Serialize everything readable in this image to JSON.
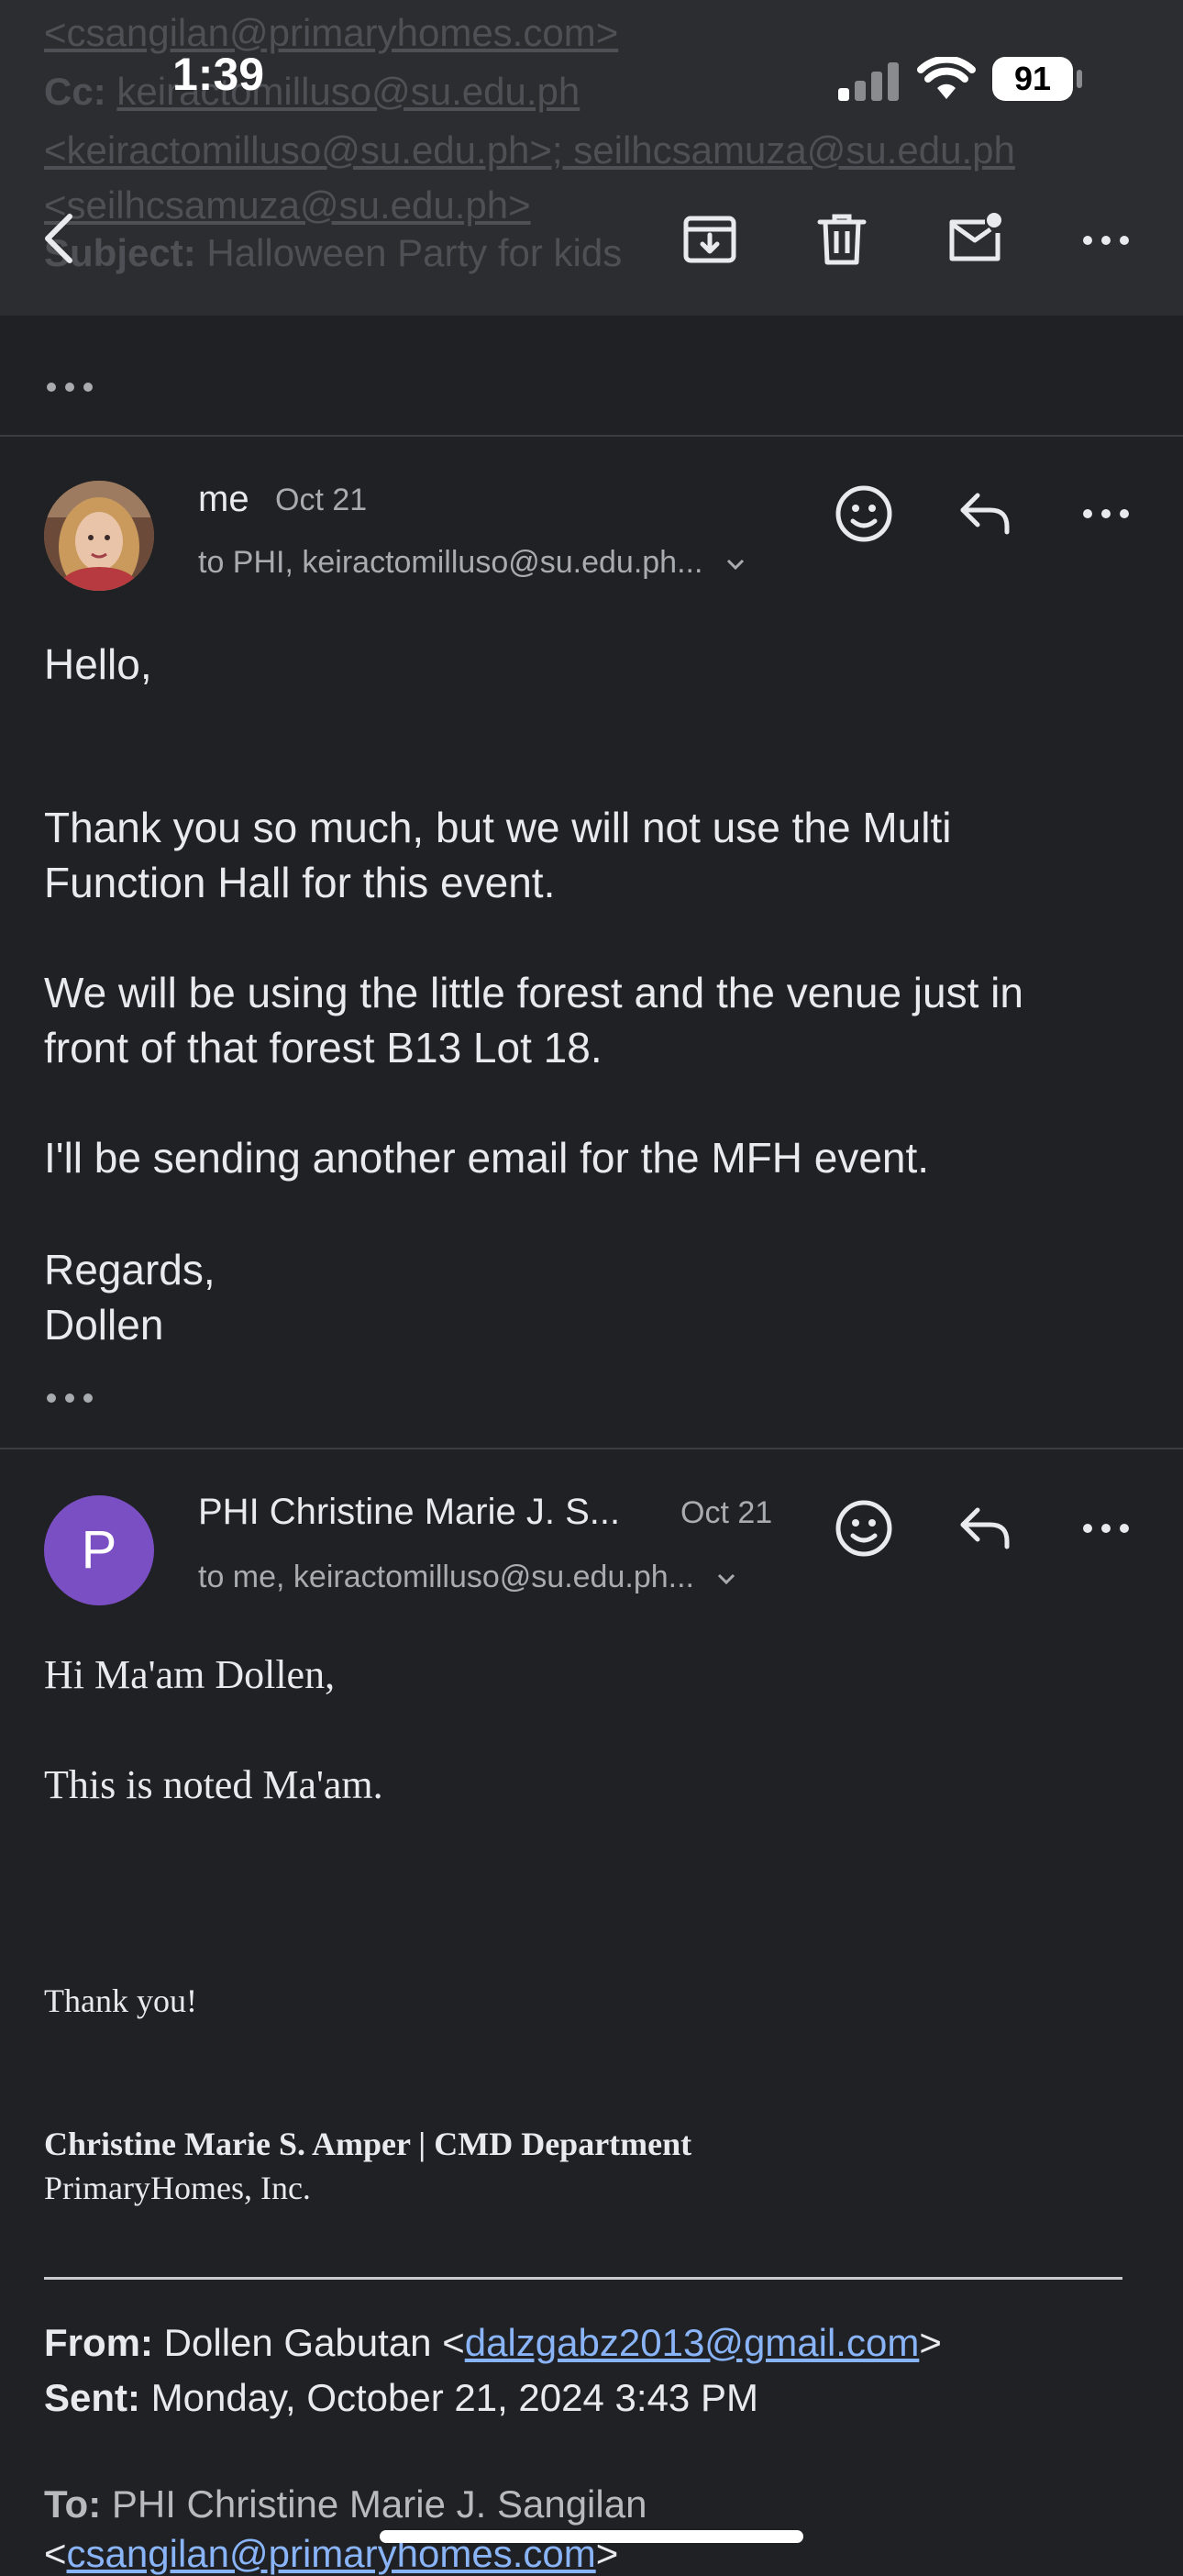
{
  "status_bar": {
    "time": "1:39",
    "battery": "91"
  },
  "header_ghost": {
    "line1": "<csangilan@primaryhomes.com>",
    "line2_label": "Cc:",
    "line2_value": "keiractomilluso@su.edu.ph",
    "line3": "<keiractomilluso@su.edu.ph>; seilhcsamuza@su.edu.ph",
    "line4": "<seilhcsamuza@su.edu.ph>",
    "line5_label": "Subject:",
    "line5_value": "Halloween Party for kids"
  },
  "toolbar": {
    "icons": [
      "back-arrow-icon",
      "archive-icon",
      "trash-icon",
      "mark-unread-icon",
      "more-icon"
    ]
  },
  "messages": [
    {
      "sender": "me",
      "date": "Oct 21",
      "recipients": "to PHI, keiractomilluso@su.edu.ph...",
      "body": [
        "Hello,",
        "Thank you so much, but we will not use the Multi\nFunction Hall for this event.",
        "We will be using the little forest and the venue just in\nfront of that forest B13 Lot 18.",
        "I'll be sending another email for the MFH event.",
        "Regards,\nDollen"
      ]
    },
    {
      "avatar_letter": "P",
      "avatar_color": "#7b4fc4",
      "sender": "PHI Christine Marie J. S...",
      "date": "Oct 21",
      "recipients": "to me, keiractomilluso@su.edu.ph...",
      "greeting": "Hi Ma'am Dollen,",
      "line2": "This is noted Ma'am.",
      "thanks": "Thank you!",
      "signature_name": "Christine Marie S. Amper | CMD Department",
      "signature_company": "PrimaryHomes, Inc.",
      "quoted": {
        "from_label": "From:",
        "from_name": "Dollen Gabutan <",
        "from_email": "dalzgabz2013@gmail.com",
        "from_close": ">",
        "sent_label": "Sent:",
        "sent_value": "Monday, October 21, 2024 3:43 PM",
        "to_label": "To:",
        "to_value": "PHI Christine Marie J. Sangilan",
        "to_email_open": "<",
        "to_email": "csangilan@primaryhomes.com",
        "to_email_close": ">"
      }
    }
  ],
  "colors": {
    "background": "#202124",
    "toolbar": "#2c2d30",
    "link": "#8ab4f8",
    "avatar_purple": "#7b4fc4"
  }
}
